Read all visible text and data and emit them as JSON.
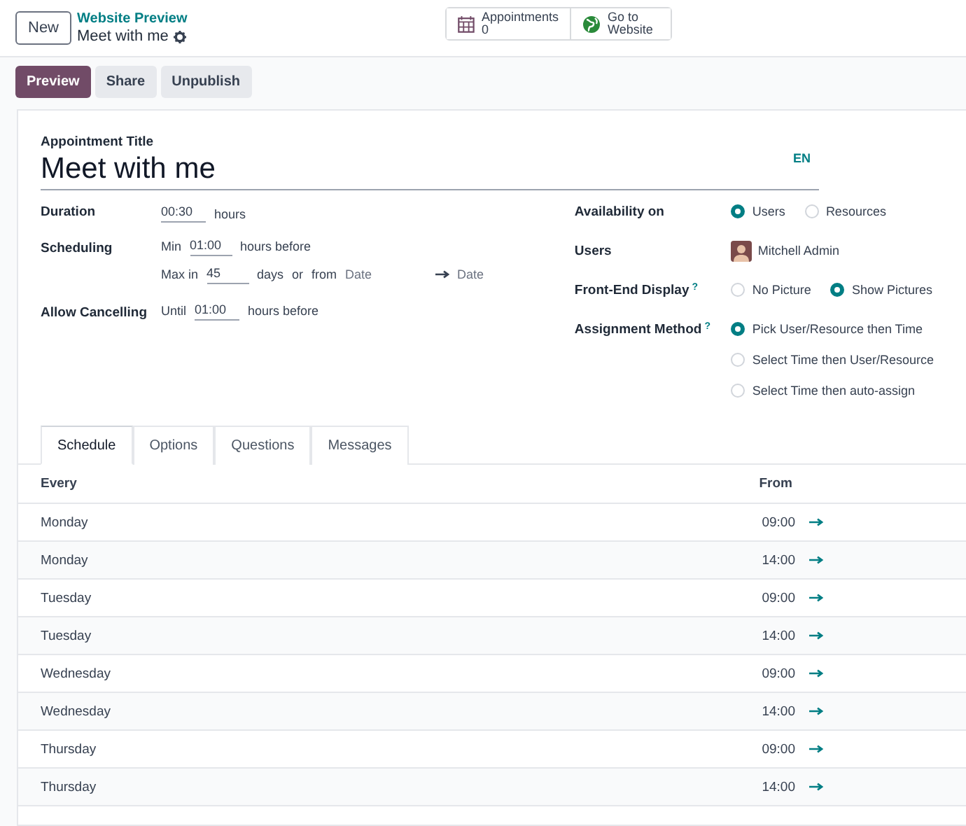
{
  "control_panel": {
    "new_button": "New",
    "breadcrumb": "Website Preview",
    "record_name": "Meet with me",
    "smart_buttons": [
      {
        "kind": "calendar",
        "label": "Appointments",
        "value": "0"
      },
      {
        "kind": "globe",
        "label": "Go to",
        "value": "Website"
      }
    ]
  },
  "action_buttons": [
    {
      "label": "Preview",
      "primary": true
    },
    {
      "label": "Share",
      "primary": false
    },
    {
      "label": "Unpublish",
      "primary": false
    }
  ],
  "form": {
    "title_label": "Appointment Title",
    "title": "Meet with me",
    "language": "EN",
    "duration": {
      "label": "Duration",
      "value": "00:30",
      "unit": "hours"
    },
    "scheduling": {
      "label": "Scheduling",
      "min_prefix": "Min",
      "min_value": "01:00",
      "min_suffix": "hours before",
      "max_prefix": "Max in",
      "max_value": "45",
      "max_unit": "days",
      "or": "or",
      "from": "from",
      "start_placeholder": "Date",
      "end_placeholder": "Date"
    },
    "cancelling": {
      "label": "Allow Cancelling",
      "prefix": "Until",
      "value": "01:00",
      "suffix": "hours before"
    },
    "availability": {
      "label": "Availability on",
      "options": [
        {
          "label": "Users",
          "selected": true
        },
        {
          "label": "Resources",
          "selected": false
        }
      ]
    },
    "users": {
      "label": "Users",
      "name": "Mitchell Admin"
    },
    "display": {
      "label": "Front-End Display",
      "help": "?",
      "options": [
        {
          "label": "No Picture",
          "selected": false
        },
        {
          "label": "Show Pictures",
          "selected": true
        }
      ]
    },
    "assignment": {
      "label": "Assignment Method",
      "help": "?",
      "options": [
        {
          "label": "Pick User/Resource then Time",
          "selected": true
        },
        {
          "label": "Select Time then User/Resource",
          "selected": false
        },
        {
          "label": "Select Time then auto-assign",
          "selected": false
        }
      ]
    }
  },
  "tabs": [
    {
      "label": "Schedule",
      "selected": true
    },
    {
      "label": "Options",
      "selected": false
    },
    {
      "label": "Questions",
      "selected": false
    },
    {
      "label": "Messages",
      "selected": false
    }
  ],
  "table": {
    "columns": [
      "Every",
      "From"
    ],
    "rows": [
      {
        "day": "Monday",
        "from": "09:00"
      },
      {
        "day": "Monday",
        "from": "14:00"
      },
      {
        "day": "Tuesday",
        "from": "09:00"
      },
      {
        "day": "Tuesday",
        "from": "14:00"
      },
      {
        "day": "Wednesday",
        "from": "09:00"
      },
      {
        "day": "Wednesday",
        "from": "14:00"
      },
      {
        "day": "Thursday",
        "from": "09:00"
      },
      {
        "day": "Thursday",
        "from": "14:00"
      }
    ]
  }
}
